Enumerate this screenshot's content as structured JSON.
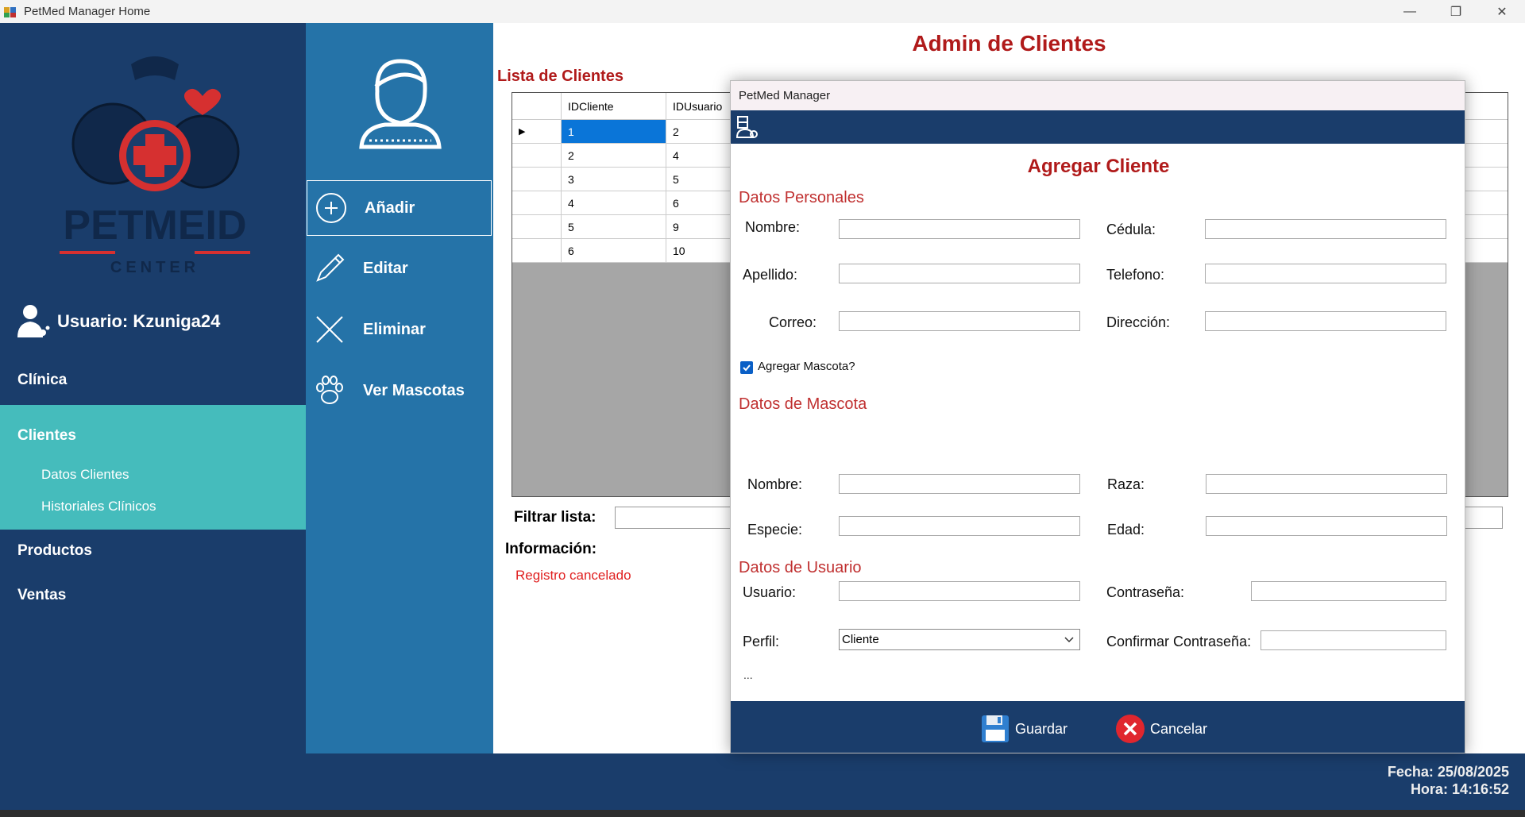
{
  "window": {
    "title": "PetMed Manager Home",
    "minimize": "—",
    "restore": "❐",
    "close": "✕"
  },
  "sidebar": {
    "logo_text": "PETMEID",
    "logo_sub": "CENTER",
    "user_label": "Usuario: Kzuniga24",
    "nav": {
      "clinica": "Clínica",
      "clientes": "Clientes",
      "datos_clientes": "Datos Clientes",
      "historiales": "Historiales Clínicos",
      "productos": "Productos",
      "ventas": "Ventas"
    }
  },
  "actions": {
    "add": "Añadir",
    "edit": "Editar",
    "delete": "Eliminar",
    "pets": "Ver Mascotas"
  },
  "main": {
    "title": "Admin de Clientes",
    "list_title": "Lista de Clientes",
    "columns": [
      "IDCliente",
      "IDUsuario"
    ],
    "rows": [
      {
        "id": "1",
        "user": "2"
      },
      {
        "id": "2",
        "user": "4"
      },
      {
        "id": "3",
        "user": "5"
      },
      {
        "id": "4",
        "user": "6"
      },
      {
        "id": "5",
        "user": "9"
      },
      {
        "id": "6",
        "user": "10"
      }
    ],
    "filter_label": "Filtrar lista:",
    "info_label": "Información:",
    "status": "Registro cancelado"
  },
  "footer": {
    "fecha": "Fecha: 25/08/2025",
    "hora": "Hora: 14:16:52"
  },
  "dialog": {
    "window_title": "PetMed Manager",
    "title": "Agregar Cliente",
    "personal_section": "Datos Personales",
    "personal": {
      "nombre": "Nombre:",
      "cedula": "Cédula:",
      "apellido": "Apellido:",
      "telefono": "Telefono:",
      "correo": "Correo:",
      "direccion": "Dirección:"
    },
    "add_pet_label": "Agregar Mascota?",
    "add_pet_checked": true,
    "pet_section": "Datos de Mascota",
    "pet": {
      "nombre": "Nombre:",
      "raza": "Raza:",
      "especie": "Especie:",
      "edad": "Edad:"
    },
    "user_section": "Datos de Usuario",
    "user": {
      "usuario": "Usuario:",
      "contrasena": "Contraseña:",
      "perfil": "Perfil:",
      "confirmar": "Confirmar Contraseña:",
      "perfil_value": "Cliente"
    },
    "ellipsis": "...",
    "save": "Guardar",
    "cancel": "Cancelar"
  },
  "colors": {
    "sidebar": "#1a3d6b",
    "actions": "#2573a8",
    "active_nav": "#45bcbc",
    "title_red": "#b01a1a",
    "selected_cell": "#0a75d8"
  }
}
